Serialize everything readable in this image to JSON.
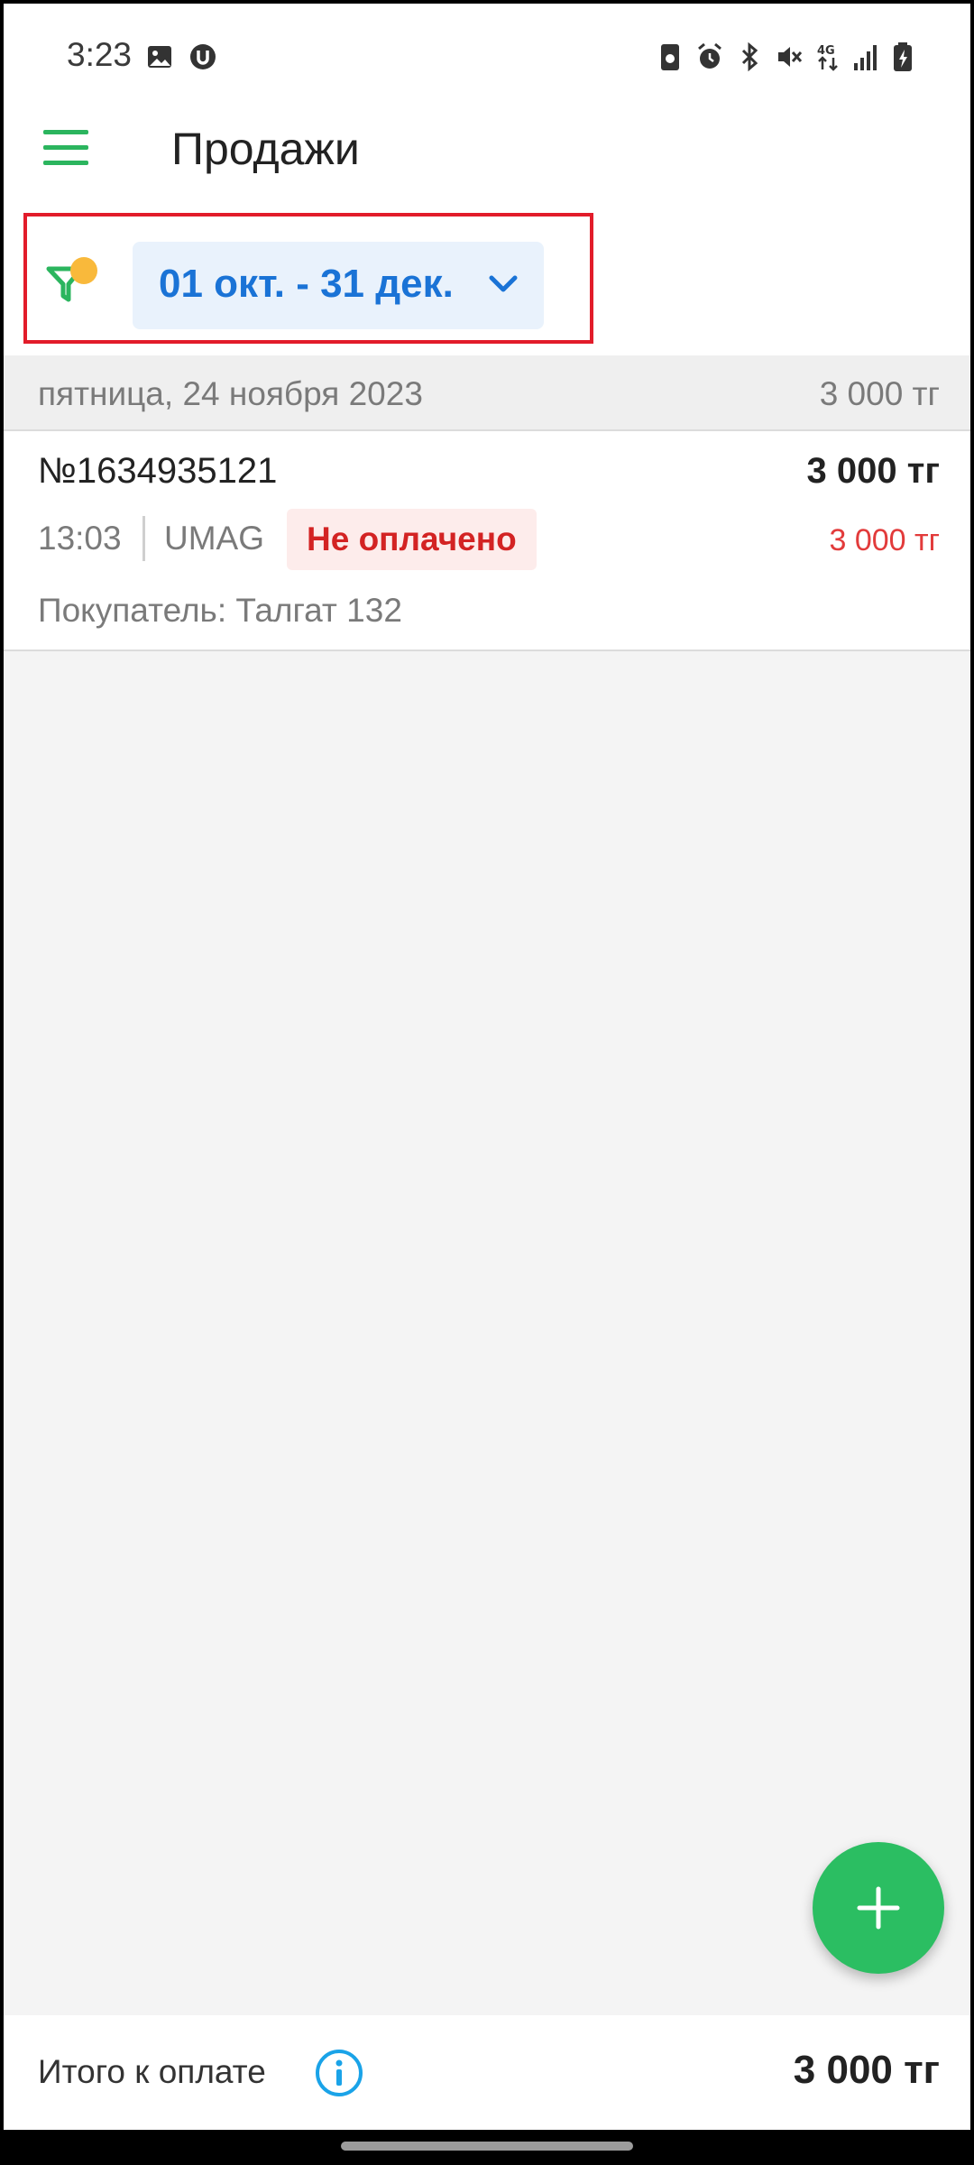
{
  "status_bar": {
    "time": "3:23"
  },
  "app_bar": {
    "title": "Продажи"
  },
  "filter": {
    "date_range": "01 окт. - 31 дек."
  },
  "group": {
    "date": "пятница, 24 ноября 2023",
    "total": "3 000 тг"
  },
  "sale": {
    "number": "№1634935121",
    "amount": "3 000 тг",
    "time": "13:03",
    "source": "UMAG",
    "status": "Не оплачено",
    "due": "3 000 тг",
    "buyer": "Покупатель: Талгат 132"
  },
  "footer": {
    "label": "Итого к оплате",
    "total": "3 000 тг"
  },
  "colors": {
    "accent_green": "#2bb55e",
    "link_blue": "#1a73d6",
    "unpaid_red": "#d32323",
    "highlight_red": "#e21c2a"
  }
}
